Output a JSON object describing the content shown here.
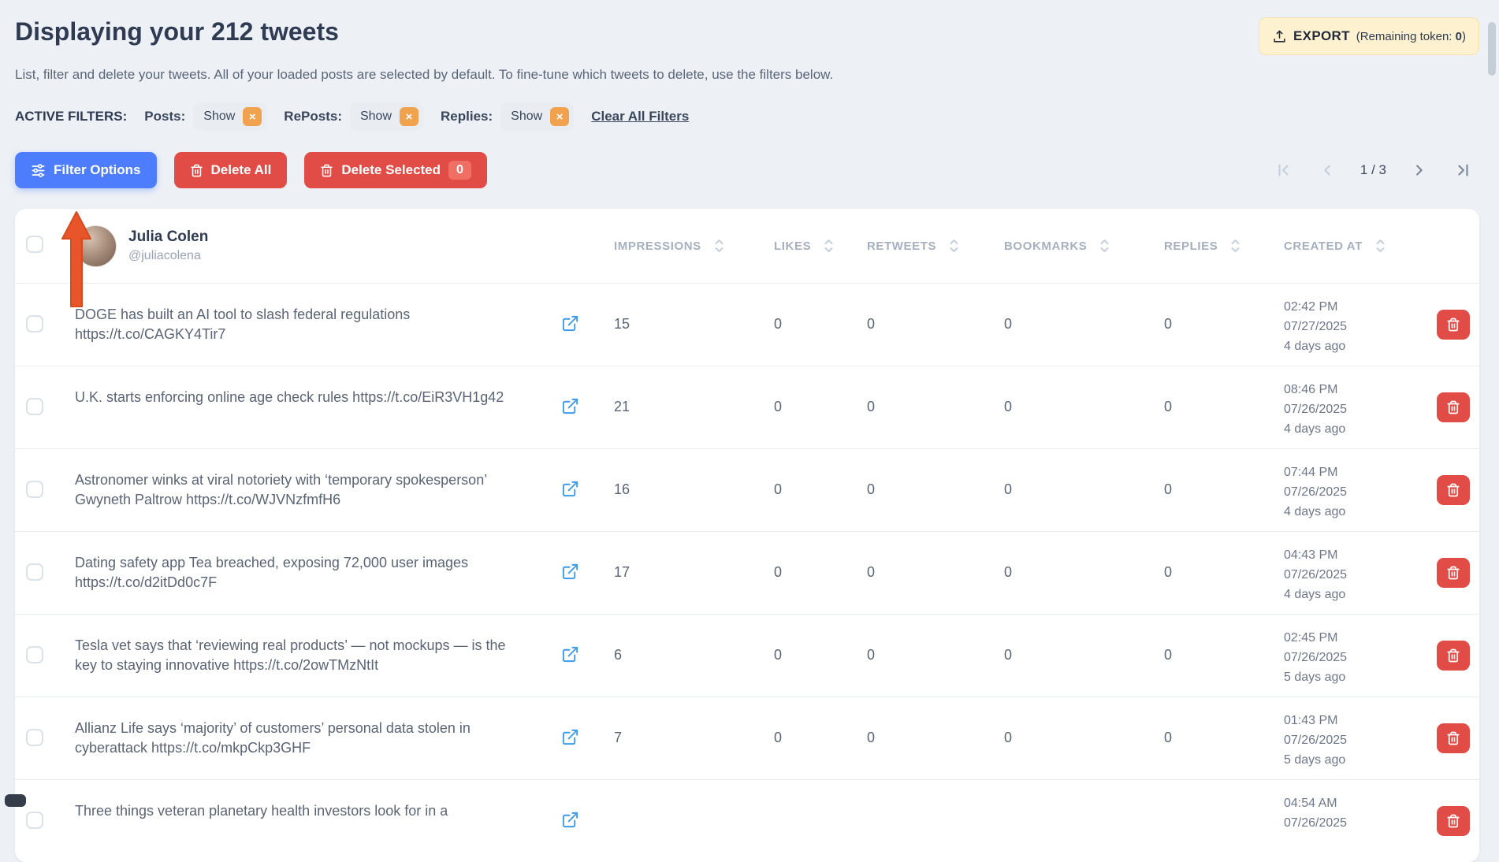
{
  "header": {
    "title_prefix": "Displaying your",
    "title_count": "212 tweets",
    "subtitle": "List, filter and delete your tweets. All of your loaded posts are selected by default. To fine-tune which tweets to delete, use the filters below.",
    "export": {
      "label": "EXPORT",
      "info_prefix": "(Remaining token: ",
      "token_count": "0",
      "info_suffix": ")"
    }
  },
  "filters": {
    "label": "ACTIVE FILTERS:",
    "items": [
      {
        "name": "Posts:",
        "value": "Show"
      },
      {
        "name": "RePosts:",
        "value": "Show"
      },
      {
        "name": "Replies:",
        "value": "Show"
      }
    ],
    "remove_icon": "×",
    "clear_label": "Clear All Filters"
  },
  "toolbar": {
    "filter_options_label": "Filter Options",
    "delete_all_label": "Delete All",
    "delete_selected_label": "Delete Selected",
    "delete_selected_count": "0"
  },
  "pagination": {
    "page_display": "1 / 3"
  },
  "user": {
    "name": "Julia Colen",
    "handle": "@juliacolena"
  },
  "table": {
    "columns": [
      "IMPRESSIONS",
      "LIKES",
      "RETWEETS",
      "BOOKMARKS",
      "REPLIES",
      "CREATED AT"
    ],
    "rows": [
      {
        "text": "DOGE has built an AI tool to slash federal regulations https://t.co/CAGKY4Tir7",
        "impressions": "15",
        "likes": "0",
        "retweets": "0",
        "bookmarks": "0",
        "replies": "0",
        "created_time": "02:42 PM",
        "created_date": "07/27/2025",
        "created_ago": "4 days ago"
      },
      {
        "text": "U.K. starts enforcing online age check rules https://t.co/EiR3VH1g42",
        "impressions": "21",
        "likes": "0",
        "retweets": "0",
        "bookmarks": "0",
        "replies": "0",
        "created_time": "08:46 PM",
        "created_date": "07/26/2025",
        "created_ago": "4 days ago"
      },
      {
        "text": "Astronomer winks at viral notoriety with ‘temporary spokesperson’ Gwyneth Paltrow https://t.co/WJVNzfmfH6",
        "impressions": "16",
        "likes": "0",
        "retweets": "0",
        "bookmarks": "0",
        "replies": "0",
        "created_time": "07:44 PM",
        "created_date": "07/26/2025",
        "created_ago": "4 days ago"
      },
      {
        "text": "Dating safety app Tea breached, exposing 72,000 user images https://t.co/d2itDd0c7F",
        "impressions": "17",
        "likes": "0",
        "retweets": "0",
        "bookmarks": "0",
        "replies": "0",
        "created_time": "04:43 PM",
        "created_date": "07/26/2025",
        "created_ago": "4 days ago"
      },
      {
        "text": "Tesla vet says that ‘reviewing real products’ — not mockups — is the key to staying innovative https://t.co/2owTMzNtIt",
        "impressions": "6",
        "likes": "0",
        "retweets": "0",
        "bookmarks": "0",
        "replies": "0",
        "created_time": "02:45 PM",
        "created_date": "07/26/2025",
        "created_ago": "5 days ago"
      },
      {
        "text": "Allianz Life says ‘majority’ of customers’ personal data stolen in cyberattack https://t.co/mkpCkp3GHF",
        "impressions": "7",
        "likes": "0",
        "retweets": "0",
        "bookmarks": "0",
        "replies": "0",
        "created_time": "01:43 PM",
        "created_date": "07/26/2025",
        "created_ago": "5 days ago"
      },
      {
        "text": "Three things veteran planetary health investors look for in a",
        "impressions": "",
        "likes": "",
        "retweets": "",
        "bookmarks": "",
        "replies": "",
        "created_time": "04:54 AM",
        "created_date": "07/26/2025",
        "created_ago": ""
      }
    ]
  },
  "colors": {
    "accent_blue": "#4d7dfd",
    "danger_red": "#e24c47",
    "chip_remove_orange": "#f0a24e",
    "export_bg": "#fdf1cf",
    "link_icon_blue": "#3d9be9",
    "annotation_arrow": "#e8552b",
    "page_bg": "#edf0f5"
  }
}
